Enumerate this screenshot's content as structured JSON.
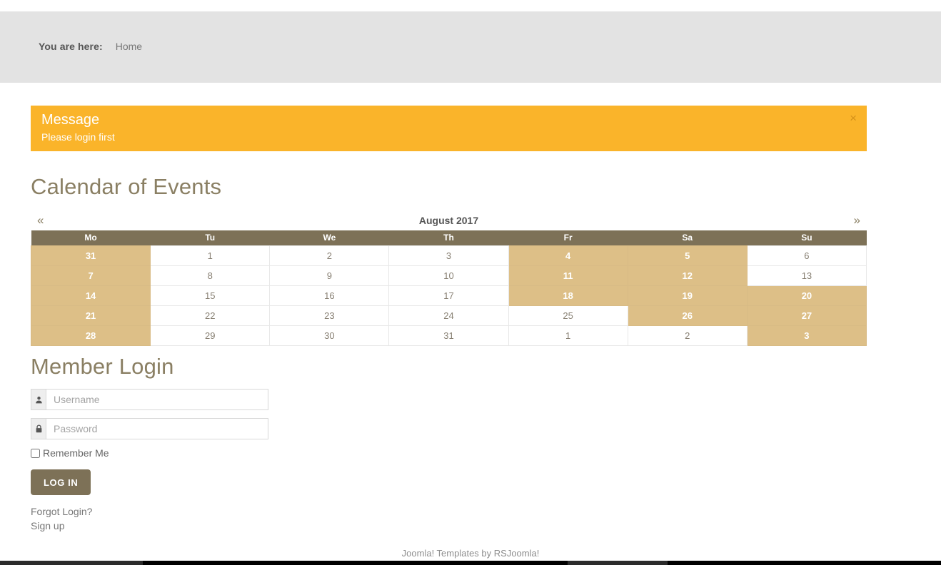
{
  "breadcrumb": {
    "label": "You are here:",
    "items": [
      "Home"
    ]
  },
  "alert": {
    "title": "Message",
    "text": "Please login first",
    "close_label": "×"
  },
  "calendar_section": {
    "heading": "Calendar of Events",
    "prev_label": "«",
    "next_label": "»",
    "month_title": "August 2017",
    "weekday_headers": [
      "Mo",
      "Tu",
      "We",
      "Th",
      "Fr",
      "Sa",
      "Su"
    ],
    "weeks": [
      [
        {
          "day": "31",
          "highlight": true
        },
        {
          "day": "1",
          "highlight": false
        },
        {
          "day": "2",
          "highlight": false
        },
        {
          "day": "3",
          "highlight": false
        },
        {
          "day": "4",
          "highlight": true
        },
        {
          "day": "5",
          "highlight": true
        },
        {
          "day": "6",
          "highlight": false
        }
      ],
      [
        {
          "day": "7",
          "highlight": true
        },
        {
          "day": "8",
          "highlight": false
        },
        {
          "day": "9",
          "highlight": false
        },
        {
          "day": "10",
          "highlight": false
        },
        {
          "day": "11",
          "highlight": true
        },
        {
          "day": "12",
          "highlight": true
        },
        {
          "day": "13",
          "highlight": false
        }
      ],
      [
        {
          "day": "14",
          "highlight": true
        },
        {
          "day": "15",
          "highlight": false
        },
        {
          "day": "16",
          "highlight": false
        },
        {
          "day": "17",
          "highlight": false
        },
        {
          "day": "18",
          "highlight": true
        },
        {
          "day": "19",
          "highlight": true
        },
        {
          "day": "20",
          "highlight": true
        }
      ],
      [
        {
          "day": "21",
          "highlight": true
        },
        {
          "day": "22",
          "highlight": false
        },
        {
          "day": "23",
          "highlight": false
        },
        {
          "day": "24",
          "highlight": false
        },
        {
          "day": "25",
          "highlight": false
        },
        {
          "day": "26",
          "highlight": true
        },
        {
          "day": "27",
          "highlight": true
        }
      ],
      [
        {
          "day": "28",
          "highlight": true
        },
        {
          "day": "29",
          "highlight": false
        },
        {
          "day": "30",
          "highlight": false
        },
        {
          "day": "31",
          "highlight": false
        },
        {
          "day": "1",
          "highlight": false
        },
        {
          "day": "2",
          "highlight": false
        },
        {
          "day": "3",
          "highlight": true
        }
      ]
    ]
  },
  "login": {
    "heading": "Member Login",
    "username_placeholder": "Username",
    "username_value": "",
    "username_icon": "user-icon",
    "password_placeholder": "Password",
    "password_value": "",
    "password_icon": "lock-icon",
    "remember_label": "Remember Me",
    "remember_checked": false,
    "submit_label": "LOG IN",
    "forgot_label": "Forgot Login?",
    "signup_label": "Sign up"
  },
  "footer": {
    "text": "Joomla! Templates by RSJoomla!"
  },
  "colors": {
    "accent_brown": "#7d7157",
    "accent_tan": "#ddbf87",
    "alert_orange": "#fab42a",
    "breadcrumb_grey": "#e3e3e3",
    "heading_brown": "#8a7f63"
  }
}
